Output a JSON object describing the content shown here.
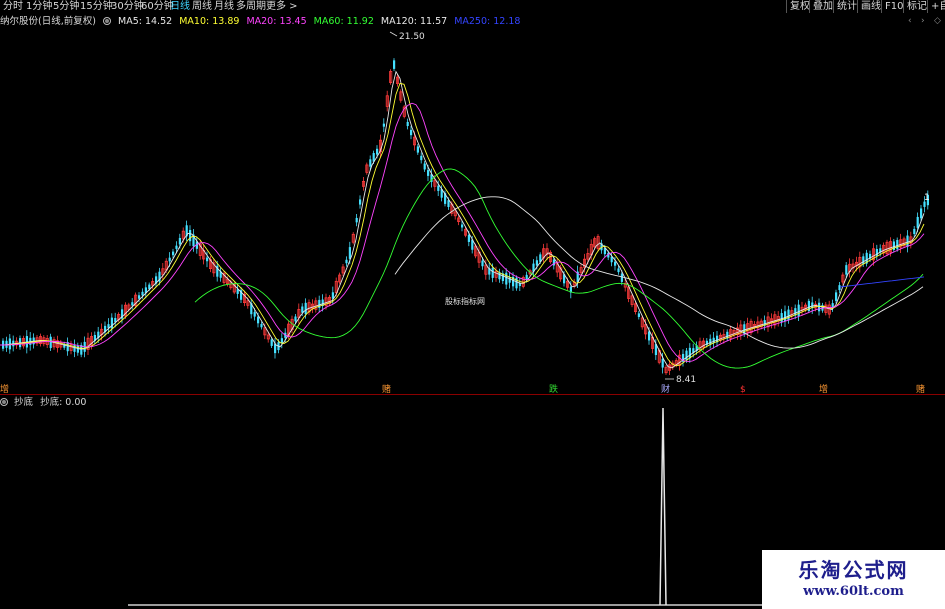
{
  "toolbar": {
    "periods": [
      "分时",
      "1分钟",
      "5分钟",
      "15分钟",
      "30分钟",
      "60分钟",
      "日线",
      "周线",
      "月线",
      "多周期",
      "更多 >"
    ],
    "active_period": "日线",
    "buttons": [
      "复权",
      "叠加",
      "统计",
      "画线",
      "F10",
      "标记",
      "+自"
    ]
  },
  "info": {
    "stock": "纳尔股份(日线,前复权)",
    "ma": [
      {
        "label": "MA5: 14.52",
        "color": "#e8e8e8"
      },
      {
        "label": "MA10: 13.89",
        "color": "#ffff33"
      },
      {
        "label": "MA20: 13.45",
        "color": "#ff44ff"
      },
      {
        "label": "MA60: 11.92",
        "color": "#33ff33"
      },
      {
        "label": "MA120: 11.57",
        "color": "#e8e8e8"
      },
      {
        "label": "MA250: 12.18",
        "color": "#3344ff"
      }
    ]
  },
  "main": {
    "high_label": "21.50",
    "low_label": "8.41",
    "watermark": "股标指标网",
    "badges": [
      {
        "text": "增",
        "color": "#ff9933"
      },
      {
        "text": "赌",
        "color": "#ff9933"
      },
      {
        "text": "跌",
        "color": "#33dd33"
      },
      {
        "text": "财",
        "color": "#aaaaff"
      },
      {
        "text": "$",
        "color": "#ff3333"
      },
      {
        "text": "增",
        "color": "#ff9933"
      },
      {
        "text": "赌",
        "color": "#ff9933"
      }
    ],
    "right_marker": "1"
  },
  "sub": {
    "title": "抄底",
    "value_label": "抄底: 0.00"
  },
  "site": {
    "title": "乐淘公式网",
    "url": "www.60lt.com"
  }
}
